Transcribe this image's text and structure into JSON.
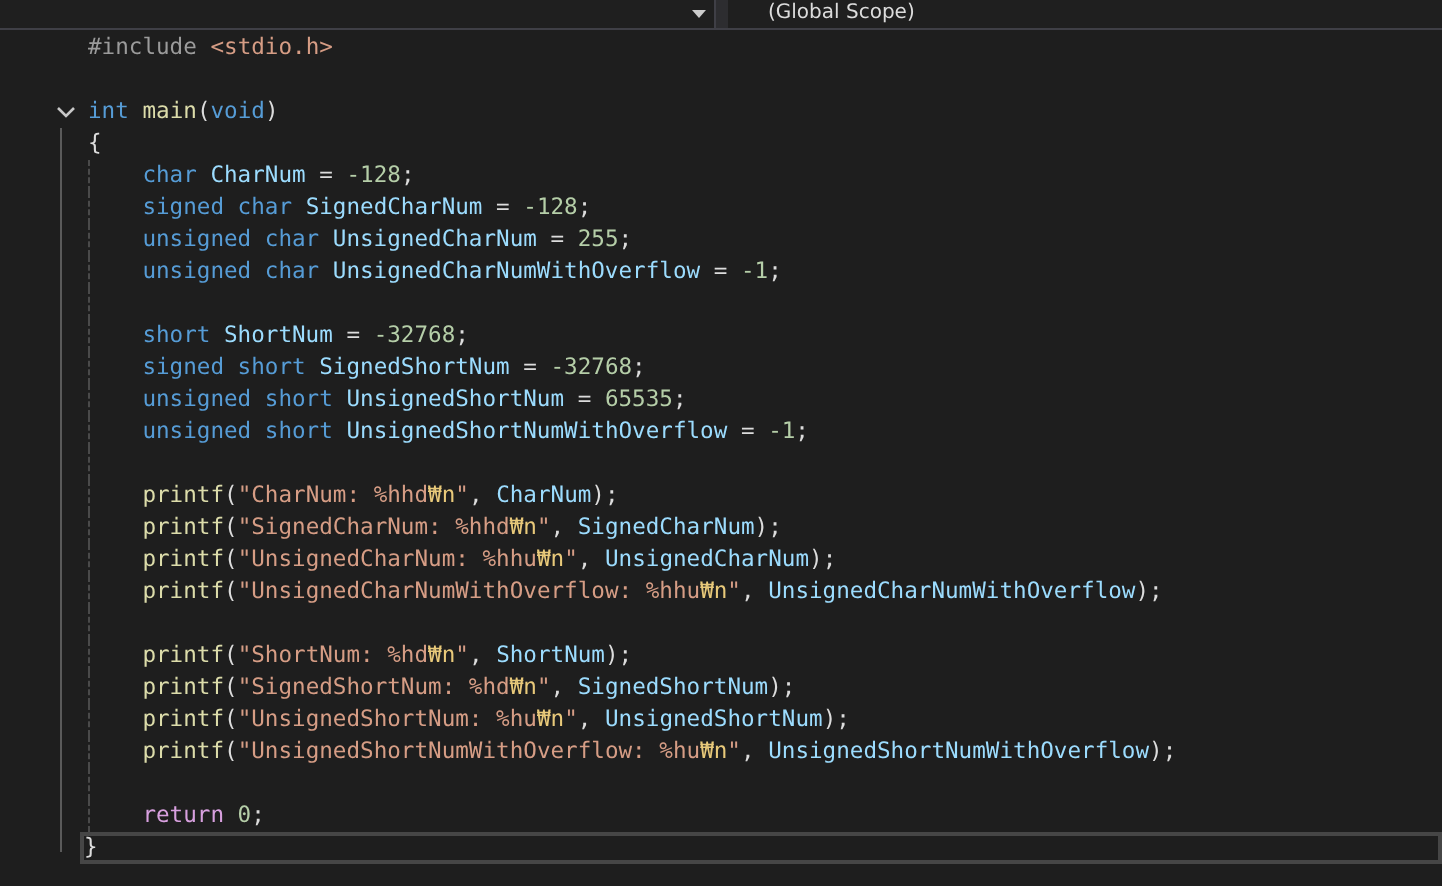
{
  "navigation_bar": {
    "scope_dropdown": "(Global Scope)"
  },
  "lines": [
    {
      "kind": "code",
      "tokens": [
        {
          "kind": "preproc",
          "text": "#include "
        },
        {
          "kind": "string",
          "text": "<stdio.h>"
        }
      ]
    },
    {
      "kind": "blank"
    },
    {
      "kind": "code",
      "fold": {
        "expanded": true
      },
      "tokens": [
        {
          "kind": "keyword",
          "text": "int "
        },
        {
          "kind": "func",
          "text": "main"
        },
        {
          "kind": "plain",
          "text": "("
        },
        {
          "kind": "keyword",
          "text": "void"
        },
        {
          "kind": "plain",
          "text": ")"
        }
      ]
    },
    {
      "kind": "code",
      "tokens": [
        {
          "kind": "plain",
          "text": "{"
        }
      ],
      "children": [
        {
          "kind": "code",
          "tokens": [
            {
              "kind": "keyword",
              "text": "char "
            },
            {
              "kind": "ident",
              "text": "CharNum"
            },
            {
              "kind": "plain",
              "text": " = "
            },
            {
              "kind": "number",
              "text": "-128"
            },
            {
              "kind": "plain",
              "text": ";"
            }
          ]
        },
        {
          "kind": "code",
          "tokens": [
            {
              "kind": "keyword",
              "text": "signed char "
            },
            {
              "kind": "ident",
              "text": "SignedCharNum"
            },
            {
              "kind": "plain",
              "text": " = "
            },
            {
              "kind": "number",
              "text": "-128"
            },
            {
              "kind": "plain",
              "text": ";"
            }
          ]
        },
        {
          "kind": "code",
          "tokens": [
            {
              "kind": "keyword",
              "text": "unsigned char "
            },
            {
              "kind": "ident",
              "text": "UnsignedCharNum"
            },
            {
              "kind": "plain",
              "text": " = "
            },
            {
              "kind": "number",
              "text": "255"
            },
            {
              "kind": "plain",
              "text": ";"
            }
          ]
        },
        {
          "kind": "code",
          "tokens": [
            {
              "kind": "keyword",
              "text": "unsigned char "
            },
            {
              "kind": "ident",
              "text": "UnsignedCharNumWithOverflow"
            },
            {
              "kind": "plain",
              "text": " = "
            },
            {
              "kind": "number",
              "text": "-1"
            },
            {
              "kind": "plain",
              "text": ";"
            }
          ]
        },
        {
          "kind": "blank"
        },
        {
          "kind": "code",
          "tokens": [
            {
              "kind": "keyword",
              "text": "short "
            },
            {
              "kind": "ident",
              "text": "ShortNum"
            },
            {
              "kind": "plain",
              "text": " = "
            },
            {
              "kind": "number",
              "text": "-32768"
            },
            {
              "kind": "plain",
              "text": ";"
            }
          ]
        },
        {
          "kind": "code",
          "tokens": [
            {
              "kind": "keyword",
              "text": "signed short "
            },
            {
              "kind": "ident",
              "text": "SignedShortNum"
            },
            {
              "kind": "plain",
              "text": " = "
            },
            {
              "kind": "number",
              "text": "-32768"
            },
            {
              "kind": "plain",
              "text": ";"
            }
          ]
        },
        {
          "kind": "code",
          "tokens": [
            {
              "kind": "keyword",
              "text": "unsigned short "
            },
            {
              "kind": "ident",
              "text": "UnsignedShortNum"
            },
            {
              "kind": "plain",
              "text": " = "
            },
            {
              "kind": "number",
              "text": "65535"
            },
            {
              "kind": "plain",
              "text": ";"
            }
          ]
        },
        {
          "kind": "code",
          "tokens": [
            {
              "kind": "keyword",
              "text": "unsigned short "
            },
            {
              "kind": "ident",
              "text": "UnsignedShortNumWithOverflow"
            },
            {
              "kind": "plain",
              "text": " = "
            },
            {
              "kind": "number",
              "text": "-1"
            },
            {
              "kind": "plain",
              "text": ";"
            }
          ]
        },
        {
          "kind": "blank"
        },
        {
          "kind": "code",
          "tokens": [
            {
              "kind": "func",
              "text": "printf"
            },
            {
              "kind": "plain",
              "text": "("
            },
            {
              "kind": "string",
              "text": "\"CharNum: %hhd"
            },
            {
              "kind": "escape",
              "text": "₩n"
            },
            {
              "kind": "string",
              "text": "\""
            },
            {
              "kind": "plain",
              "text": ", "
            },
            {
              "kind": "ident",
              "text": "CharNum"
            },
            {
              "kind": "plain",
              "text": ");"
            }
          ]
        },
        {
          "kind": "code",
          "tokens": [
            {
              "kind": "func",
              "text": "printf"
            },
            {
              "kind": "plain",
              "text": "("
            },
            {
              "kind": "string",
              "text": "\"SignedCharNum: %hhd"
            },
            {
              "kind": "escape",
              "text": "₩n"
            },
            {
              "kind": "string",
              "text": "\""
            },
            {
              "kind": "plain",
              "text": ", "
            },
            {
              "kind": "ident",
              "text": "SignedCharNum"
            },
            {
              "kind": "plain",
              "text": ");"
            }
          ]
        },
        {
          "kind": "code",
          "tokens": [
            {
              "kind": "func",
              "text": "printf"
            },
            {
              "kind": "plain",
              "text": "("
            },
            {
              "kind": "string",
              "text": "\"UnsignedCharNum: %hhu"
            },
            {
              "kind": "escape",
              "text": "₩n"
            },
            {
              "kind": "string",
              "text": "\""
            },
            {
              "kind": "plain",
              "text": ", "
            },
            {
              "kind": "ident",
              "text": "UnsignedCharNum"
            },
            {
              "kind": "plain",
              "text": ");"
            }
          ]
        },
        {
          "kind": "code",
          "tokens": [
            {
              "kind": "func",
              "text": "printf"
            },
            {
              "kind": "plain",
              "text": "("
            },
            {
              "kind": "string",
              "text": "\"UnsignedCharNumWithOverflow: %hhu"
            },
            {
              "kind": "escape",
              "text": "₩n"
            },
            {
              "kind": "string",
              "text": "\""
            },
            {
              "kind": "plain",
              "text": ", "
            },
            {
              "kind": "ident",
              "text": "UnsignedCharNumWithOverflow"
            },
            {
              "kind": "plain",
              "text": ");"
            }
          ]
        },
        {
          "kind": "blank"
        },
        {
          "kind": "code",
          "tokens": [
            {
              "kind": "func",
              "text": "printf"
            },
            {
              "kind": "plain",
              "text": "("
            },
            {
              "kind": "string",
              "text": "\"ShortNum: %hd"
            },
            {
              "kind": "escape",
              "text": "₩n"
            },
            {
              "kind": "string",
              "text": "\""
            },
            {
              "kind": "plain",
              "text": ", "
            },
            {
              "kind": "ident",
              "text": "ShortNum"
            },
            {
              "kind": "plain",
              "text": ");"
            }
          ]
        },
        {
          "kind": "code",
          "tokens": [
            {
              "kind": "func",
              "text": "printf"
            },
            {
              "kind": "plain",
              "text": "("
            },
            {
              "kind": "string",
              "text": "\"SignedShortNum: %hd"
            },
            {
              "kind": "escape",
              "text": "₩n"
            },
            {
              "kind": "string",
              "text": "\""
            },
            {
              "kind": "plain",
              "text": ", "
            },
            {
              "kind": "ident",
              "text": "SignedShortNum"
            },
            {
              "kind": "plain",
              "text": ");"
            }
          ]
        },
        {
          "kind": "code",
          "tokens": [
            {
              "kind": "func",
              "text": "printf"
            },
            {
              "kind": "plain",
              "text": "("
            },
            {
              "kind": "string",
              "text": "\"UnsignedShortNum: %hu"
            },
            {
              "kind": "escape",
              "text": "₩n"
            },
            {
              "kind": "string",
              "text": "\""
            },
            {
              "kind": "plain",
              "text": ", "
            },
            {
              "kind": "ident",
              "text": "UnsignedShortNum"
            },
            {
              "kind": "plain",
              "text": ");"
            }
          ]
        },
        {
          "kind": "code",
          "tokens": [
            {
              "kind": "func",
              "text": "printf"
            },
            {
              "kind": "plain",
              "text": "("
            },
            {
              "kind": "string",
              "text": "\"UnsignedShortNumWithOverflow: %hu"
            },
            {
              "kind": "escape",
              "text": "₩n"
            },
            {
              "kind": "string",
              "text": "\""
            },
            {
              "kind": "plain",
              "text": ", "
            },
            {
              "kind": "ident",
              "text": "UnsignedShortNumWithOverflow"
            },
            {
              "kind": "plain",
              "text": ");"
            }
          ]
        },
        {
          "kind": "blank"
        },
        {
          "kind": "code",
          "tokens": [
            {
              "kind": "control",
              "text": "return "
            },
            {
              "kind": "number",
              "text": "0"
            },
            {
              "kind": "plain",
              "text": ";"
            }
          ]
        }
      ]
    },
    {
      "kind": "code",
      "current": true,
      "tokens": [
        {
          "kind": "plain",
          "text": "}"
        }
      ]
    }
  ]
}
